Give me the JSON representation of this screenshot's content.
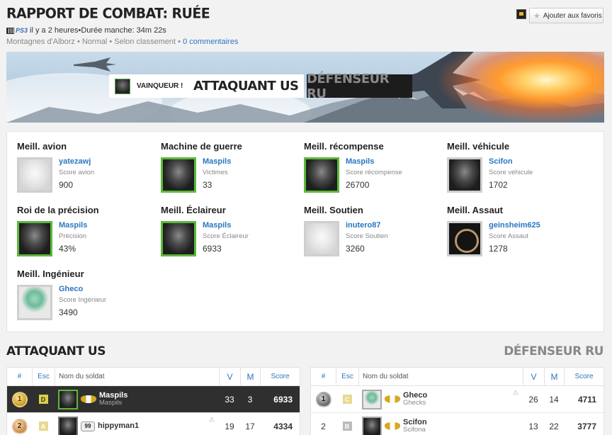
{
  "header": {
    "title": "RAPPORT DE COMBAT: RUÉE",
    "platform": "PS3",
    "time_ago": "il y a 2 heures",
    "duration": "Durée manche: 34m 22s",
    "map": "Montagnes d'Alborz",
    "difficulty": "Normal",
    "mode": "Selon classement",
    "comments": "0 commentaires",
    "sep": " • ",
    "favorite_label": "Ajouter aux favoris"
  },
  "banner": {
    "winner_label": "VAINQUEUR !",
    "winner_team": "ATTAQUANT US",
    "loser_team": "DÉFENSEUR RU"
  },
  "awards": [
    {
      "title": "Meill. avion",
      "player": "yatezawj",
      "stat": "Score avion",
      "value": "900"
    },
    {
      "title": "Machine de guerre",
      "player": "Maspils",
      "stat": "Victimes",
      "value": "33"
    },
    {
      "title": "Meill. récompense",
      "player": "Maspils",
      "stat": "Score récompense",
      "value": "26700"
    },
    {
      "title": "Meill. véhicule",
      "player": "Scifon",
      "stat": "Score véhicule",
      "value": "1702"
    },
    {
      "title": "Roi de la précision",
      "player": "Maspils",
      "stat": "Précision",
      "value": "43%"
    },
    {
      "title": "Meill. Éclaireur",
      "player": "Maspils",
      "stat": "Score Éclaireur",
      "value": "6933"
    },
    {
      "title": "Meill. Soutien",
      "player": "inutero87",
      "stat": "Score Soutien",
      "value": "3260"
    },
    {
      "title": "Meill. Assaut",
      "player": "geinsheim625",
      "stat": "Score Assaut",
      "value": "1278"
    },
    {
      "title": "Meill. Ingénieur",
      "player": "Gheco",
      "stat": "Score Ingénieur",
      "value": "3490"
    }
  ],
  "teams": {
    "left_title": "ATTAQUANT US",
    "right_title": "DÉFENSEUR RU"
  },
  "table_headers": {
    "rank": "#",
    "squad": "Esc",
    "name": "Nom du soldat",
    "kills": "V",
    "deaths": "M",
    "score": "Score"
  },
  "left_rows": [
    {
      "rank": "1",
      "squad": "D",
      "name": "Maspils",
      "tag": "Maspils",
      "rank_badge": "33",
      "kills": "33",
      "deaths": "3",
      "score": "6933"
    },
    {
      "rank": "2",
      "squad": "A",
      "name": "hippyman1",
      "tag": "",
      "rank_badge": "99",
      "kills": "19",
      "deaths": "17",
      "score": "4334"
    }
  ],
  "right_rows": [
    {
      "rank": "1",
      "squad": "C",
      "name": "Gheco",
      "tag": "Ghecks",
      "kills": "26",
      "deaths": "14",
      "score": "4711"
    },
    {
      "rank": "2",
      "squad": "B",
      "name": "Scifon",
      "tag": "Scifona",
      "kills": "13",
      "deaths": "22",
      "score": "3777"
    }
  ],
  "warning_icon": "⚠"
}
